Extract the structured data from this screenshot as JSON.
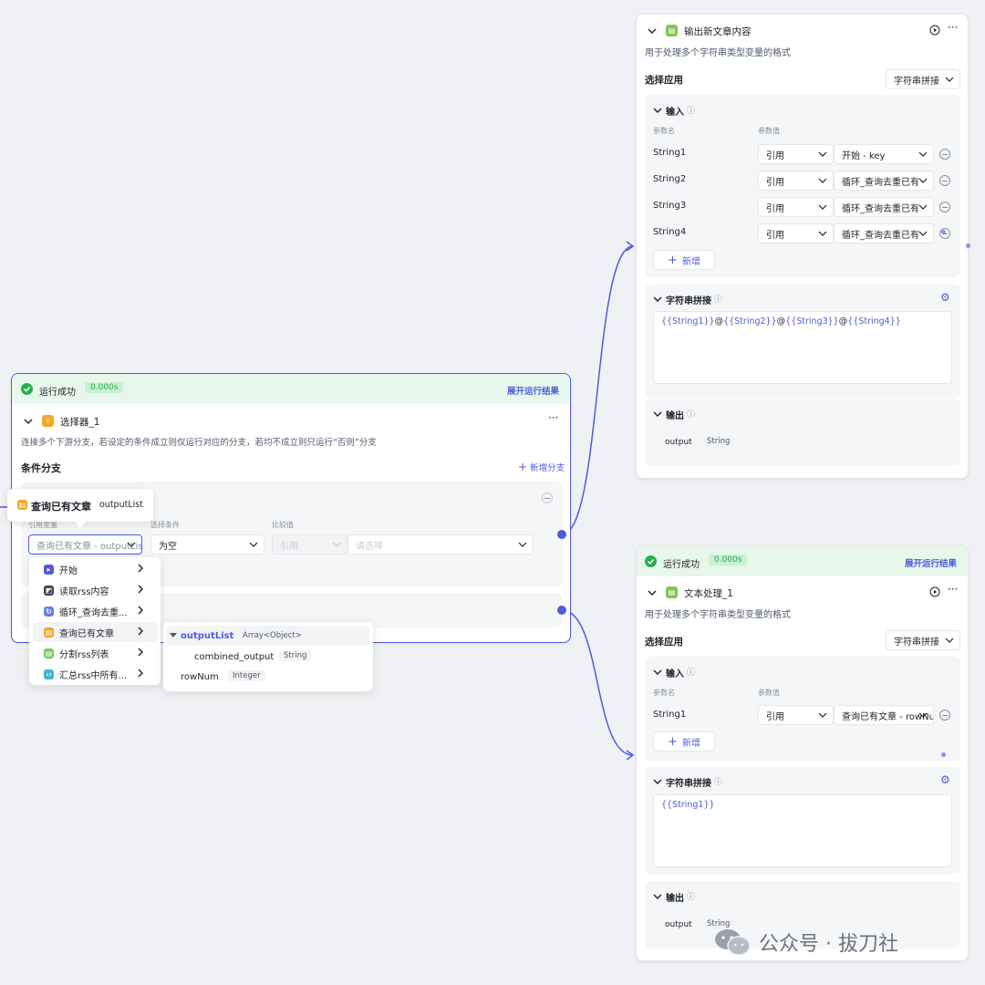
{
  "top_node": {
    "title": "输出新文章内容",
    "description": "用于处理多个字符串类型变量的格式",
    "select_app_label": "选择应用",
    "select_app_value": "字符串拼接",
    "input_section": "输入",
    "col_param_name": "参数名",
    "col_param_value": "参数值",
    "params": [
      {
        "name": "String1",
        "type": "引用",
        "value": "开始 - key"
      },
      {
        "name": "String2",
        "type": "引用",
        "value": "循环_查询去重已有"
      },
      {
        "name": "String3",
        "type": "引用",
        "value": "循环_查询去重已有"
      },
      {
        "name": "String4",
        "type": "引用",
        "value": "循环_查询去重已有"
      }
    ],
    "add_label": "新增",
    "concat_section": "字符串拼接",
    "concat_parts": [
      "{{String1}}",
      "@",
      "{{String2}}",
      "@",
      "{{String3}}",
      "@",
      "{{String4}}"
    ],
    "output_section": "输出",
    "output_name": "output",
    "output_type": "String"
  },
  "selector_node": {
    "status": "运行成功",
    "time": "0.000s",
    "expand_label": "展开运行结果",
    "title": "选择器_1",
    "description": "连接多个下游分支，若设定的条件成立则仅运行对应的分支，若均不成立则只运行“否则”分支",
    "branch_label": "条件分支",
    "add_branch_label": "新增分支",
    "col_variable": "引用变量",
    "col_condition": "选择条件",
    "col_compare": "比较值",
    "variable_value": "查询已有文章 - outputList",
    "condition_value": "为空",
    "compare_type": "引用",
    "compare_placeholder": "请选择"
  },
  "tooltip": {
    "node": "查询已有文章",
    "field": "outputList"
  },
  "dropdown": {
    "items": [
      {
        "label": "开始",
        "color": "#4e5bdc"
      },
      {
        "label": "读取rss内容",
        "color": "#3a4150"
      },
      {
        "label": "循环_查询去重...",
        "color": "#6b7cf0"
      },
      {
        "label": "查询已有文章",
        "color": "#f5a623"
      },
      {
        "label": "分割rss列表",
        "color": "#7bc75a"
      },
      {
        "label": "汇总rss中所有...",
        "color": "#3fb8c9"
      }
    ]
  },
  "submenu": {
    "field": "outputList",
    "field_type": "Array<Object>",
    "child": "combined_output",
    "child_type": "String",
    "other": "rowNum",
    "other_type": "Integer"
  },
  "bottom_node": {
    "status": "运行成功",
    "time": "0.000s",
    "expand_label": "展开运行结果",
    "title": "文本处理_1",
    "description": "用于处理多个字符串类型变量的格式",
    "select_app_label": "选择应用",
    "select_app_value": "字符串拼接",
    "input_section": "输入",
    "col_param_name": "参数名",
    "col_param_value": "参数值",
    "params": [
      {
        "name": "String1",
        "type": "引用",
        "value": "查询已有文章 - rowNum"
      }
    ],
    "add_label": "新增",
    "concat_section": "字符串拼接",
    "concat_value": "{{String1}}",
    "output_section": "输出",
    "output_name": "output",
    "output_type": "String"
  },
  "watermark": {
    "text": "公众号 · 拔刀社"
  },
  "colors": {
    "accent": "#4e5bdc",
    "success_bg": "#e8f7ec",
    "success": "#27b04b"
  }
}
